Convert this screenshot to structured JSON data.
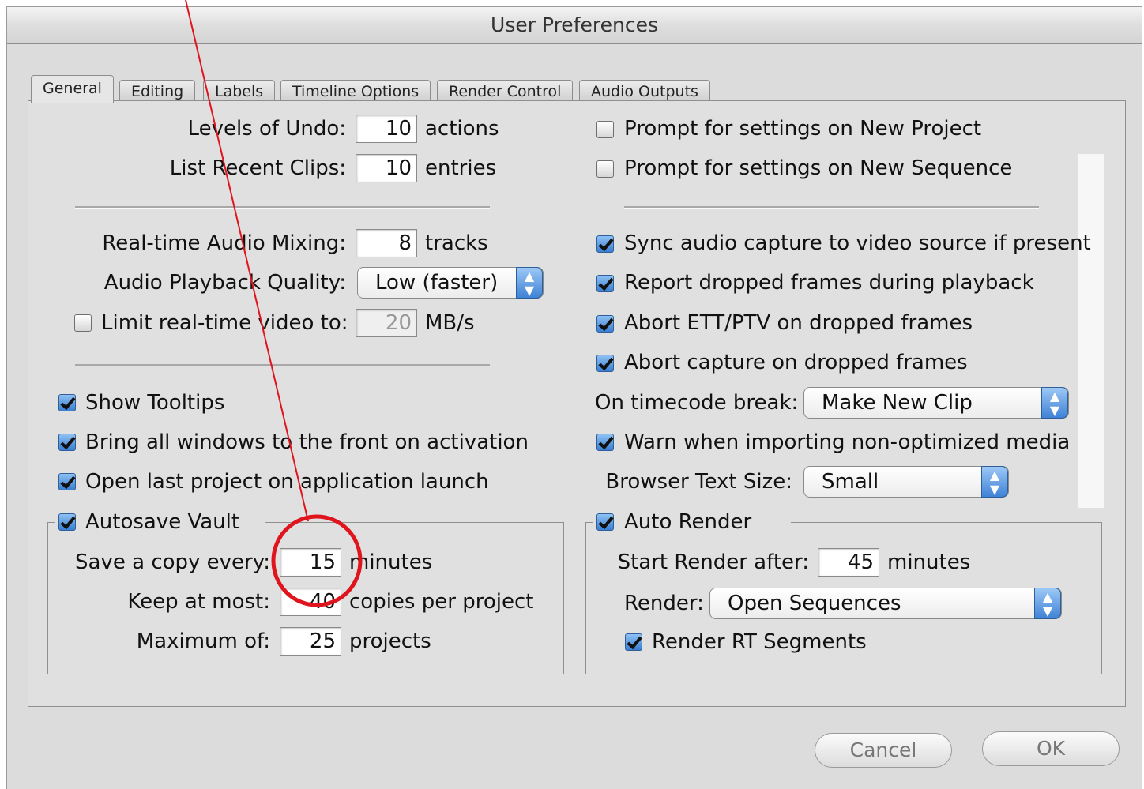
{
  "window": {
    "title": "User Preferences"
  },
  "tabs": [
    "General",
    "Editing",
    "Labels",
    "Timeline Options",
    "Render Control",
    "Audio Outputs"
  ],
  "left": {
    "levels_undo": {
      "label": "Levels of Undo:",
      "value": "10",
      "unit": "actions"
    },
    "recent_clips": {
      "label": "List Recent Clips:",
      "value": "10",
      "unit": "entries"
    },
    "audio_mixing": {
      "label": "Real-time Audio Mixing:",
      "value": "8",
      "unit": "tracks"
    },
    "playback_quality": {
      "label": "Audio Playback Quality:",
      "value": "Low (faster)"
    },
    "limit_video": {
      "label": "Limit real-time video to:",
      "value": "20",
      "unit": "MB/s",
      "checked": false
    },
    "show_tooltips": {
      "label": "Show Tooltips",
      "checked": true
    },
    "bring_windows": {
      "label": "Bring all windows to the front on activation",
      "checked": true
    },
    "open_last": {
      "label": "Open last project on application launch",
      "checked": true
    },
    "autosave": {
      "label": "Autosave Vault",
      "checked": true,
      "save_copy": {
        "label": "Save a copy every:",
        "value": "15",
        "unit": "minutes"
      },
      "keep_most": {
        "label": "Keep at most:",
        "value": "40",
        "unit": "copies per project"
      },
      "maximum": {
        "label": "Maximum of:",
        "value": "25",
        "unit": "projects"
      }
    }
  },
  "right": {
    "prompt_project": {
      "label": "Prompt for settings on New Project",
      "checked": false
    },
    "prompt_sequence": {
      "label": "Prompt for settings on New Sequence",
      "checked": false
    },
    "sync_audio": {
      "label": "Sync audio capture to video source if present",
      "checked": true
    },
    "report_dropped": {
      "label": "Report dropped frames during playback",
      "checked": true
    },
    "abort_ett": {
      "label": "Abort ETT/PTV on dropped frames",
      "checked": true
    },
    "abort_capture": {
      "label": "Abort capture on dropped frames",
      "checked": true
    },
    "timecode_break": {
      "label": "On timecode break:",
      "value": "Make New Clip"
    },
    "warn_import": {
      "label": "Warn when importing non-optimized media",
      "checked": true
    },
    "browser_text": {
      "label": "Browser Text Size:",
      "value": "Small"
    },
    "auto_render": {
      "label": "Auto Render",
      "checked": true,
      "start_after": {
        "label": "Start Render after:",
        "value": "45",
        "unit": "minutes"
      },
      "render": {
        "label": "Render:",
        "value": "Open Sequences"
      },
      "rt_segments": {
        "label": "Render RT Segments",
        "checked": true
      }
    }
  },
  "buttons": {
    "cancel": "Cancel",
    "ok": "OK"
  },
  "annotation_color": "#e0141c"
}
